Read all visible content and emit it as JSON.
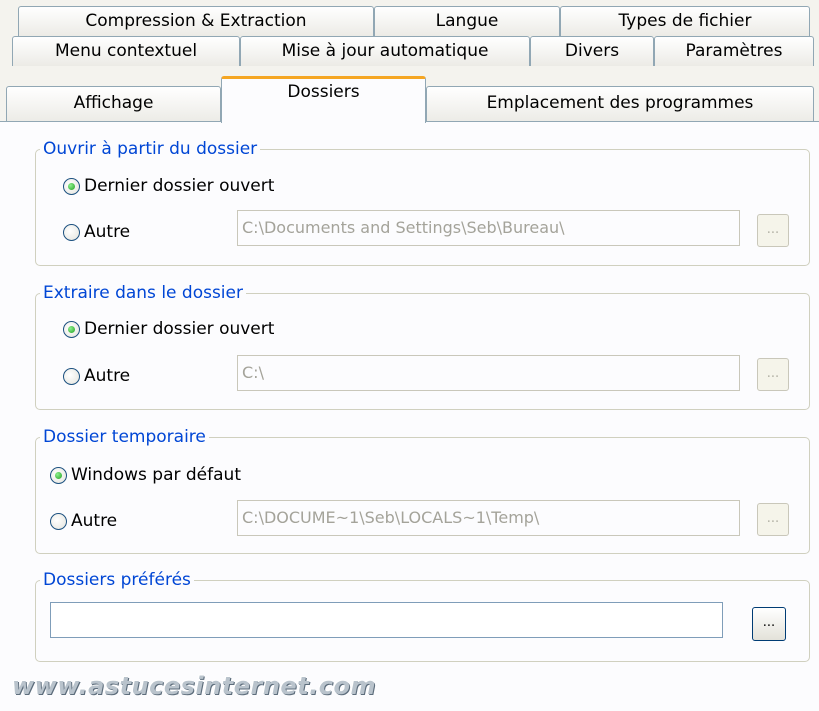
{
  "tabs": {
    "row1": [
      "Compression & Extraction",
      "Langue",
      "Types de fichier"
    ],
    "row2": [
      "Menu contextuel",
      "Mise à jour automatique",
      "Divers",
      "Paramètres"
    ],
    "row3": [
      "Affichage",
      "Dossiers",
      "Emplacement des programmes"
    ],
    "active": "Dossiers"
  },
  "groups": {
    "open_from": {
      "legend": "Ouvrir à partir du dossier",
      "option1": "Dernier dossier ouvert",
      "option2": "Autre",
      "path": "C:\\Documents and Settings\\Seb\\Bureau\\",
      "browse": "..."
    },
    "extract_to": {
      "legend": "Extraire dans le dossier",
      "option1": "Dernier dossier ouvert",
      "option2": "Autre",
      "path": "C:\\",
      "browse": "..."
    },
    "temp": {
      "legend": "Dossier temporaire",
      "option1": "Windows par défaut",
      "option2": "Autre",
      "path": "C:\\DOCUME~1\\Seb\\LOCALS~1\\Temp\\",
      "browse": "..."
    },
    "favorites": {
      "legend": "Dossiers préférés",
      "path": "",
      "browse": "..."
    }
  },
  "watermark": "www.astucesinternet.com",
  "colors": {
    "legend": "#0046d5",
    "active_tab_accent": "#f5a623",
    "radio_selected": "#21a121"
  }
}
